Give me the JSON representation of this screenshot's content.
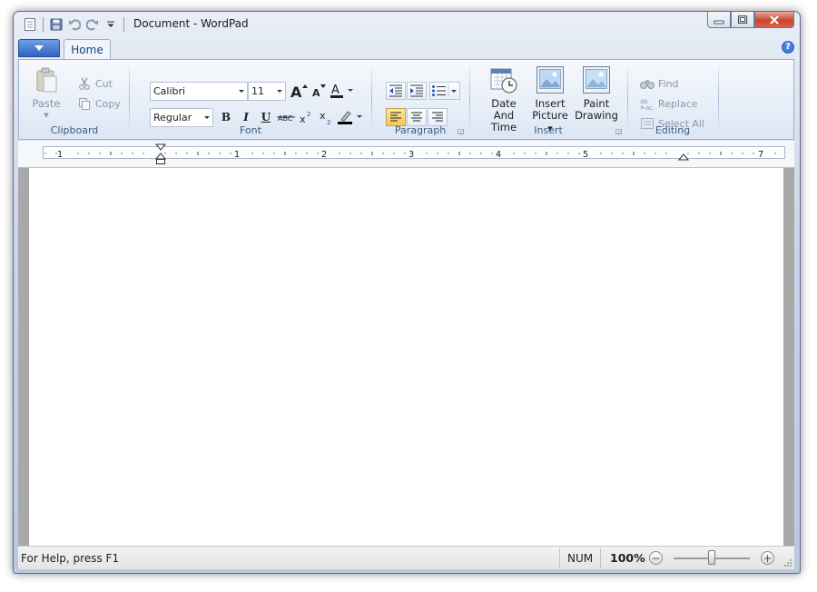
{
  "window": {
    "title": "Document - WordPad"
  },
  "quick_access": {
    "icons": [
      "document-icon",
      "save-icon",
      "undo-icon",
      "redo-icon",
      "customize-dropdown-icon"
    ]
  },
  "tabs": {
    "home": "Home"
  },
  "ribbon": {
    "clipboard": {
      "label": "Clipboard",
      "paste": "Paste",
      "cut": "Cut",
      "copy": "Copy"
    },
    "font": {
      "label": "Font",
      "family": "Calibri",
      "size": "11",
      "style": "Regular"
    },
    "paragraph": {
      "label": "Paragraph"
    },
    "insert": {
      "label": "Insert",
      "date_time_1": "Date And",
      "date_time_2": "Time",
      "picture_1": "Insert",
      "picture_2": "Picture",
      "paint_1": "Paint",
      "paint_2": "Drawing"
    },
    "editing": {
      "label": "Editing",
      "find": "Find",
      "replace": "Replace",
      "select_all": "Select All"
    }
  },
  "ruler": {
    "labels": [
      "1",
      "1",
      "2",
      "3",
      "4",
      "5",
      "7"
    ]
  },
  "status": {
    "help": "For Help, press F1",
    "num": "NUM",
    "zoom": "100%",
    "zoom_level": 0.5
  },
  "colors": {
    "accent": "#15428b",
    "font_color": "#1f1f1f",
    "highlight": "#000000"
  }
}
